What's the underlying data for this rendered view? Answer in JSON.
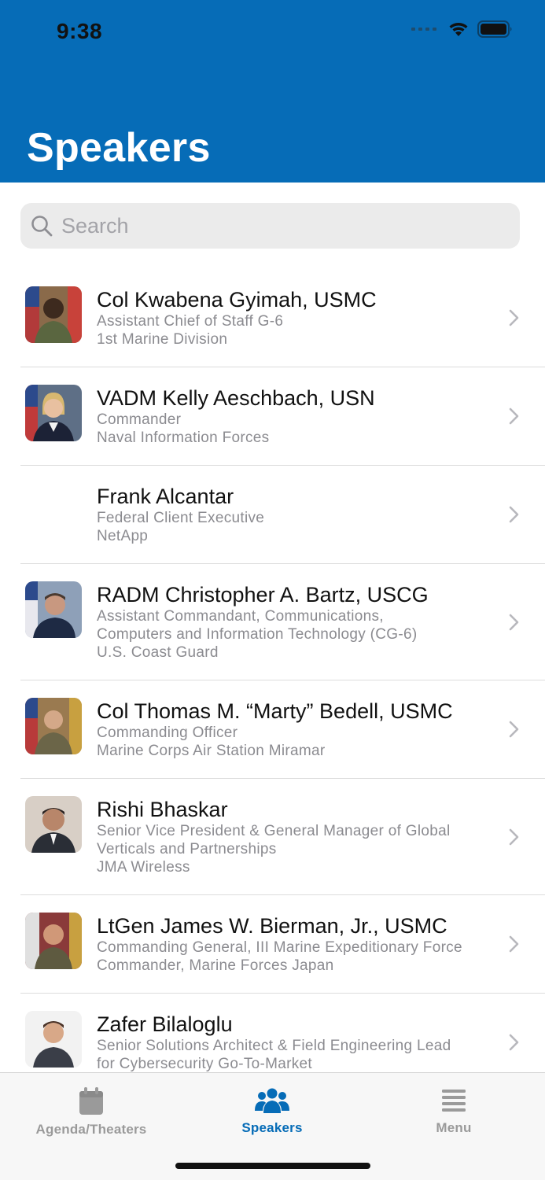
{
  "status_bar": {
    "time": "9:38"
  },
  "header": {
    "title": "Speakers",
    "bg_color": "#066cb7"
  },
  "search": {
    "placeholder": "Search",
    "value": ""
  },
  "speakers": [
    {
      "name": "Col Kwabena  Gyimah, USMC",
      "lines": [
        "Assistant Chief of Staff G-6",
        "1st Marine Division"
      ],
      "has_photo": true
    },
    {
      "name": "VADM Kelly Aeschbach, USN",
      "lines": [
        "Commander",
        "Naval Information Forces"
      ],
      "has_photo": true
    },
    {
      "name": "Frank Alcantar",
      "lines": [
        "Federal Client Executive",
        "NetApp"
      ],
      "has_photo": false
    },
    {
      "name": "RADM Christopher A.  Bartz, USCG",
      "lines": [
        "Assistant Commandant, Communications,",
        "Computers and Information Technology (CG-6)",
        "U.S. Coast Guard"
      ],
      "has_photo": true
    },
    {
      "name": "Col Thomas M. “Marty” Bedell, USMC",
      "lines": [
        "Commanding Officer",
        "Marine Corps Air Station Miramar"
      ],
      "has_photo": true
    },
    {
      "name": "Rishi Bhaskar",
      "lines": [
        "Senior Vice President & General Manager of Global",
        "Verticals and Partnerships",
        "JMA Wireless"
      ],
      "has_photo": true
    },
    {
      "name": "LtGen James W.  Bierman, Jr., USMC",
      "lines": [
        "Commanding General, III Marine Expeditionary Force",
        "Commander, Marine Forces Japan"
      ],
      "has_photo": true
    },
    {
      "name": "Zafer Bilaloglu",
      "lines": [
        "Senior Solutions Architect & Field Engineering Lead",
        "for Cybersecurity Go-To-Market"
      ],
      "has_photo": true
    }
  ],
  "tabs": [
    {
      "label": "Agenda/Theaters",
      "icon": "calendar-icon",
      "active": false
    },
    {
      "label": "Speakers",
      "icon": "people-icon",
      "active": true
    },
    {
      "label": "Menu",
      "icon": "menu-icon",
      "active": false
    }
  ],
  "colors": {
    "accent": "#066cb7",
    "inactive_tab": "#9a9a9a",
    "secondary_text": "#8b8b90"
  }
}
